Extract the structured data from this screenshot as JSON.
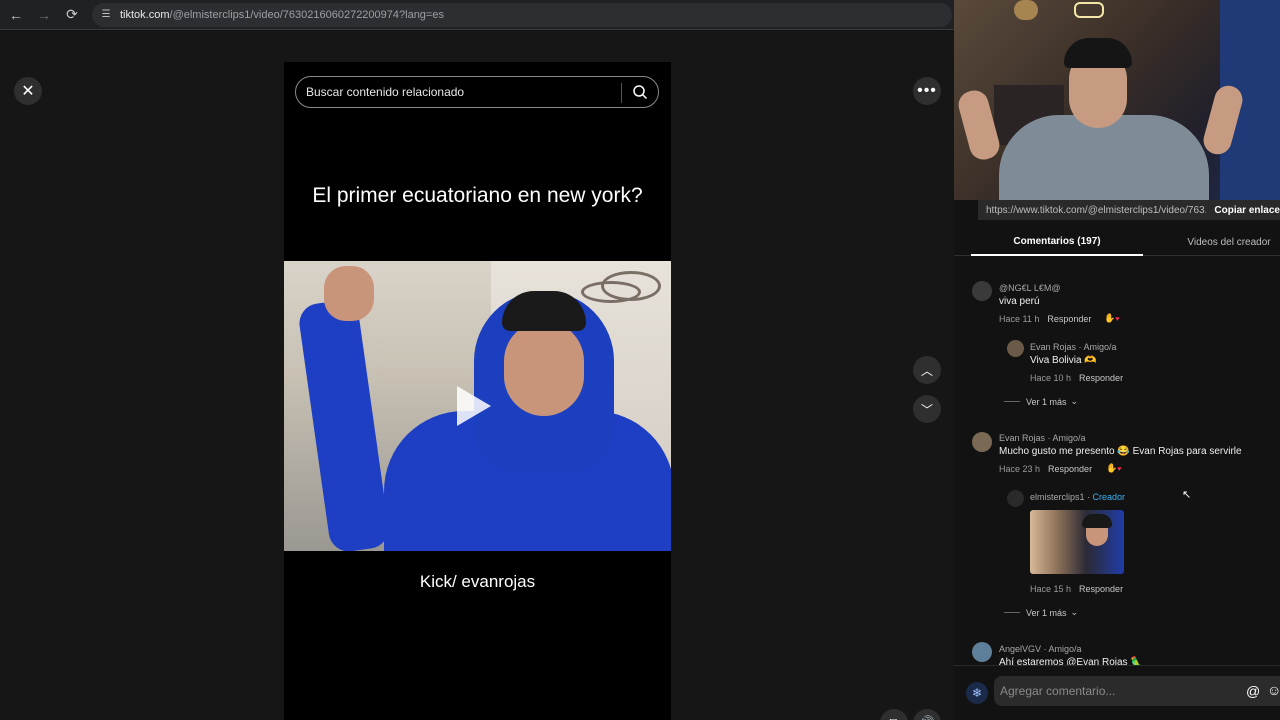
{
  "browser": {
    "url_domain": "tiktok.com",
    "url_path": "/@elmisterclips1/video/7630216060272200974?lang=es",
    "back_icon": "←",
    "forward_icon": "→",
    "reload_icon": "⟳"
  },
  "video": {
    "search_placeholder": "Buscar contenido relacionado",
    "caption_top": "El primer ecuatoriano en new york?",
    "caption_bottom": "Kick/ evanrojas",
    "close_icon": "✕",
    "more_icon": "•••",
    "up_icon": "︿",
    "down_icon": "﹀",
    "pip_icon": "⧉",
    "volume_icon": "🔊"
  },
  "panel": {
    "link_text": "https://www.tiktok.com/@elmisterclips1/video/763...",
    "copy_label": "Copiar enlace",
    "tabs": [
      {
        "label": "Comentarios (197)"
      },
      {
        "label": "Videos del creador"
      }
    ],
    "comments": [
      {
        "author": "@NG€L L€M@",
        "text": "viva perú",
        "time": "Hace 11 h",
        "reply": "Responder"
      },
      {
        "author": "Evan Rojas · Amigo/a",
        "text": "Viva Bolivia 🫶",
        "time": "Hace 10 h",
        "reply": "Responder"
      },
      {
        "more": "Ver 1 más"
      },
      {
        "author": "Evan Rojas · Amigo/a",
        "text": "Mucho gusto me presento 😂 Evan Rojas para servirle",
        "time": "Hace 23 h",
        "reply": "Responder"
      },
      {
        "author": "elmisterclips1",
        "badge": "Creador",
        "time": "Hace 15 h",
        "reply": "Responder"
      },
      {
        "more": "Ver 1 más"
      },
      {
        "author": "AngelVGV · Amigo/a",
        "text": "Ahí estaremos @Evan Rojas 🦜"
      }
    ],
    "composer_placeholder": "Agregar comentario...",
    "mention_icon": "@",
    "emoji_icon": "☺"
  },
  "colors": {
    "accent_heart": "#fe2c55",
    "creator_badge": "#3db1f5",
    "background": "#121212"
  }
}
